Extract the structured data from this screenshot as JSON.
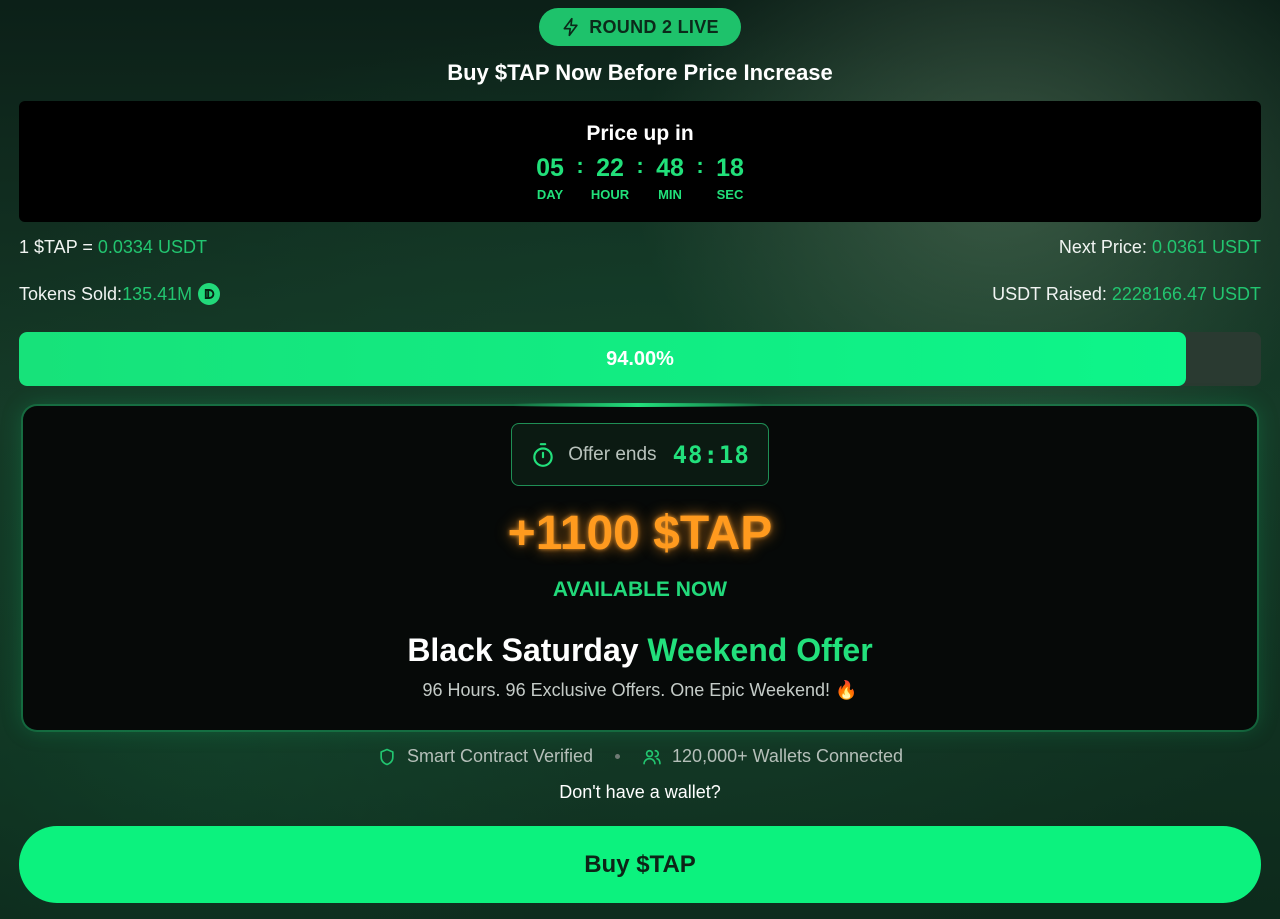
{
  "round_badge": {
    "label": "ROUND 2 LIVE",
    "icon": "lightning-icon"
  },
  "headline": "Buy $TAP Now Before Price Increase",
  "countdown": {
    "title": "Price up in",
    "units": [
      {
        "value": "05",
        "label": "DAY"
      },
      {
        "value": "22",
        "label": "HOUR"
      },
      {
        "value": "48",
        "label": "MIN"
      },
      {
        "value": "18",
        "label": "SEC"
      }
    ],
    "separator": ":"
  },
  "price": {
    "current_prefix": "1 $TAP = ",
    "current_value": "0.0334 USDT",
    "next_label": "Next Price: ",
    "next_value": "0.0361 USDT"
  },
  "stats": {
    "tokens_sold_label": "Tokens Sold: ",
    "tokens_sold_value": "135.41M",
    "usdt_raised_label": "USDT Raised: ",
    "usdt_raised_value": "2228166.47 USDT"
  },
  "progress": {
    "percent": 94.0,
    "label": "94.00%"
  },
  "offer": {
    "ends_label": "Offer ends",
    "ends_time": "48:18",
    "bonus": "+1100 $TAP",
    "available": "AVAILABLE NOW",
    "title_main": "Black Saturday ",
    "title_accent": "Weekend Offer",
    "subtitle": "96 Hours. 96 Exclusive Offers. One Epic Weekend! 🔥"
  },
  "trust": {
    "verified": "Smart Contract Verified",
    "wallets": "120,000+ Wallets Connected"
  },
  "no_wallet": "Don't have a wallet?",
  "buy_button": "Buy $TAP",
  "colors": {
    "accent": "#22e07c",
    "bonus": "#ff9a1e",
    "button": "#0cf27e",
    "badge": "#1ec26b"
  }
}
